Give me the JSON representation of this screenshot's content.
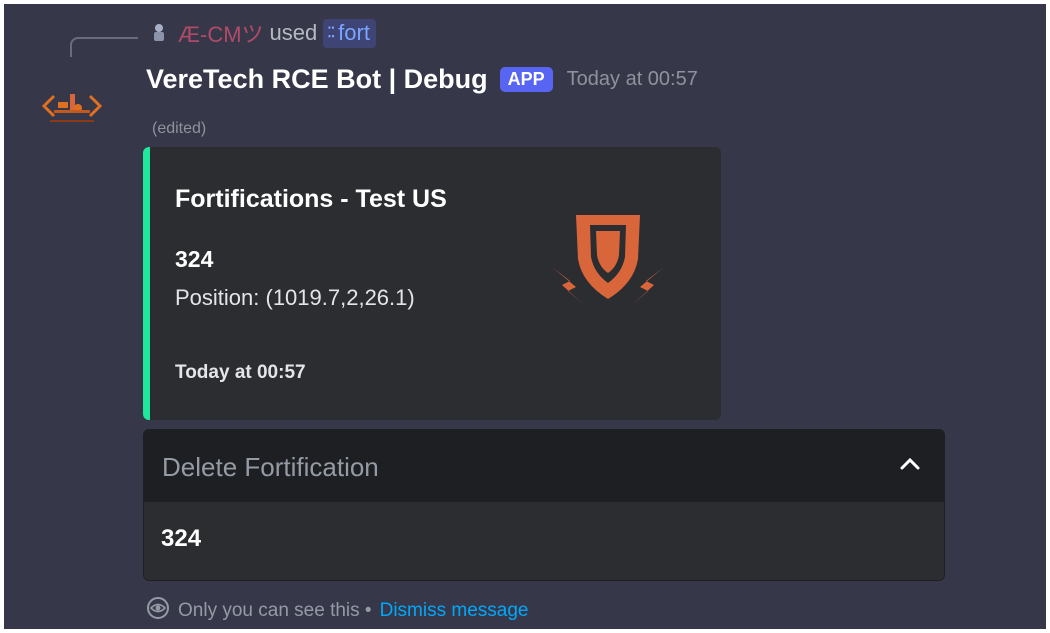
{
  "reply": {
    "user": "Æ-CMツ",
    "verb": "used",
    "command": "fort",
    "command_icon": "slash-command-icon"
  },
  "message": {
    "bot_name": "VereTech RCE Bot | Debug",
    "app_tag": "APP",
    "timestamp": "Today at 00:57",
    "edited": "(edited)"
  },
  "embed": {
    "title": "Fortifications - Test US",
    "number": "324",
    "position": "Position: (1019.7,2,26.1)",
    "footer_time": "Today at 00:57",
    "accent_color": "#1fe89c",
    "thumbnail": "shield-lightning-icon"
  },
  "select_menu": {
    "placeholder": "Delete Fortification",
    "options": [
      "324"
    ],
    "expanded": true
  },
  "ephemeral": {
    "text": "Only you can see this •",
    "dismiss": "Dismiss message"
  },
  "colors": {
    "background": "#36384a",
    "embed_bg": "#2b2d31",
    "app_tag": "#5865f2",
    "link": "#00a8fc",
    "reply_user": "#b04a67",
    "icon_orange": "#d9663a"
  }
}
